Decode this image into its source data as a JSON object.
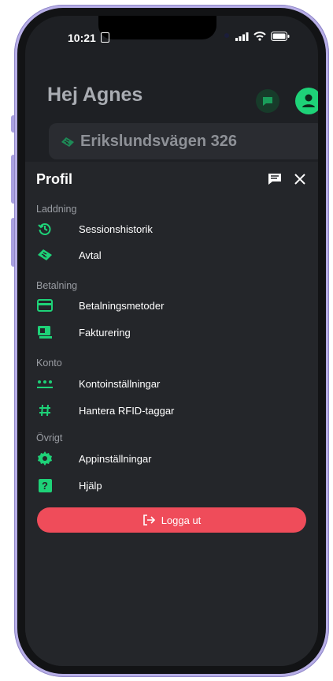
{
  "status": {
    "time": "10:21"
  },
  "header": {
    "greeting": "Hej Agnes",
    "address": "Erikslundsvägen 326"
  },
  "profile": {
    "title": "Profil",
    "sections": [
      {
        "label": "Laddning",
        "items": [
          {
            "label": "Sessionshistorik",
            "icon": "history-icon"
          },
          {
            "label": "Avtal",
            "icon": "agreement-icon"
          }
        ]
      },
      {
        "label": "Betalning",
        "items": [
          {
            "label": "Betalningsmetoder",
            "icon": "credit-card-icon"
          },
          {
            "label": "Fakturering",
            "icon": "invoice-icon"
          }
        ]
      },
      {
        "label": "Konto",
        "items": [
          {
            "label": "Kontoinställningar",
            "icon": "password-icon"
          },
          {
            "label": "Hantera RFID-taggar",
            "icon": "hashtag-icon"
          }
        ]
      },
      {
        "label": "Övrigt",
        "items": [
          {
            "label": "Appinställningar",
            "icon": "gear-icon"
          },
          {
            "label": "Hjälp",
            "icon": "help-icon"
          }
        ]
      }
    ],
    "logout_label": "Logga ut"
  },
  "colors": {
    "accent": "#1ed278",
    "danger": "#ef4c5a",
    "sheet": "#24262a"
  }
}
